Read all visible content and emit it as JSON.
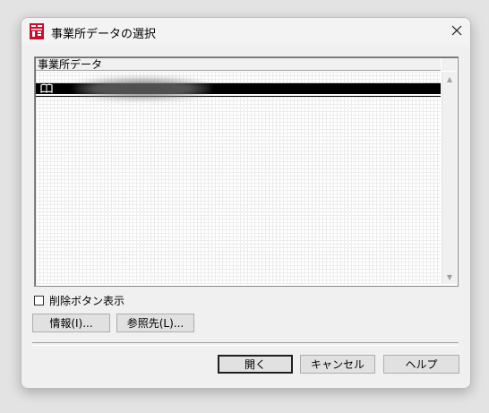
{
  "window": {
    "title": "事業所データの選択",
    "close_icon": "close-icon"
  },
  "list": {
    "column_header": "事業所データ",
    "selected_row_icon": "book-icon"
  },
  "options": {
    "show_delete_button_label": "削除ボタン表示",
    "show_delete_button_checked": false
  },
  "buttons": {
    "info": "情報(I)...",
    "browse": "参照先(L)...",
    "open": "開く",
    "cancel": "キャンセル",
    "help": "ヘルプ"
  }
}
